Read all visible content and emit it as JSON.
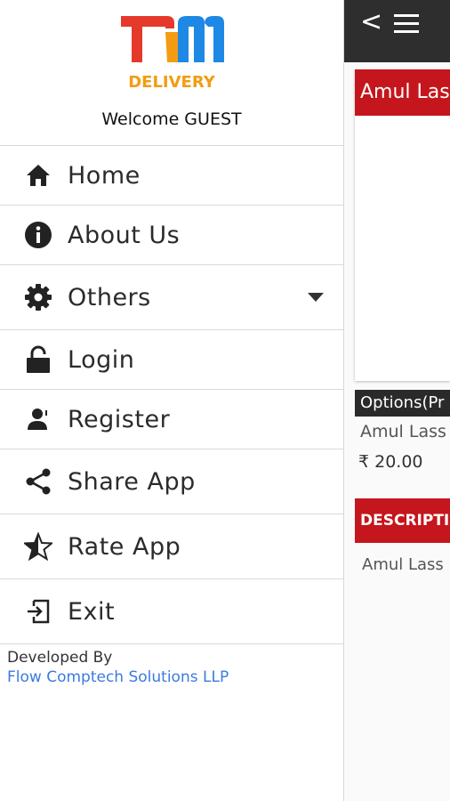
{
  "brand": {
    "logo_letters": "fm",
    "logo_word": "DELIVERY",
    "colors": {
      "red": "#e53a2b",
      "blue": "#1e88e5",
      "orange": "#f39c12"
    }
  },
  "drawer": {
    "welcome": "Welcome GUEST",
    "items": [
      {
        "label": "Home",
        "icon": "home-icon"
      },
      {
        "label": "About Us",
        "icon": "info-icon"
      },
      {
        "label": "Others",
        "icon": "gear-icon",
        "expandable": true
      },
      {
        "label": "Login",
        "icon": "unlock-icon"
      },
      {
        "label": "Register",
        "icon": "register-user-icon"
      },
      {
        "label": "Share App",
        "icon": "share-icon"
      },
      {
        "label": "Rate App",
        "icon": "star-icon"
      },
      {
        "label": "Exit",
        "icon": "exit-icon"
      }
    ],
    "footer": {
      "developed_by": "Developed By",
      "company": "Flow Comptech Solutions LLP"
    }
  },
  "background_screen": {
    "product_title": "Amul Las",
    "options_label": "Options(Pr",
    "option_name": "Amul Lass",
    "option_price": "₹ 20.00",
    "description_label": "DESCRIPTIO",
    "description_text": "Amul Lass",
    "accent_color": "#c4161c",
    "appbar_color": "#2e2e2e"
  }
}
